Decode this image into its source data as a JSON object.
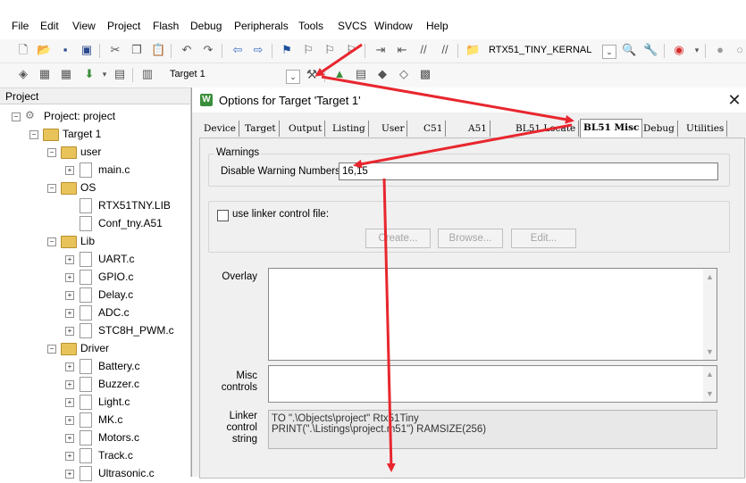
{
  "colors": {
    "arrow": "#e8262e",
    "folder": "#e8c35a",
    "app_icon": "#3a8f3a"
  },
  "menubar": {
    "items": [
      "File",
      "Edit",
      "View",
      "Project",
      "Flash",
      "Debug",
      "Peripherals",
      "Tools",
      "SVCS",
      "Window",
      "Help"
    ]
  },
  "toolbar1": {
    "target_combo": "RTX51_TINY_KERNAL",
    "icons": [
      "new-file-icon",
      "open-icon",
      "save-icon",
      "save-all-icon",
      "cut-icon",
      "copy-icon",
      "paste-icon",
      "undo-icon",
      "redo-icon",
      "nav-back-icon",
      "nav-forward-icon",
      "bookmark-icon",
      "prev-bookmark-icon",
      "next-bookmark-icon",
      "clear-bookmark-icon",
      "indent-icon",
      "unindent-icon",
      "comment-icon",
      "uncomment-icon",
      "find-in-files-icon",
      "find-icon",
      "configure-icon",
      "debug-icon",
      "breakpoint-icon"
    ]
  },
  "toolbar2": {
    "target_select": "Target 1",
    "icons": [
      "translate-icon",
      "build-icon",
      "rebuild-icon",
      "batch-build-icon",
      "stop-build-icon",
      "download-icon",
      "options-for-target-icon",
      "manage-components-icon",
      "select-software-packs-icon",
      "pack-installer-icon",
      "books-icon"
    ]
  },
  "project": {
    "header": "Project",
    "root": "Project: project",
    "target": "Target 1",
    "groups": [
      {
        "name": "user",
        "files": [
          "main.c"
        ]
      },
      {
        "name": "OS",
        "files": [
          "RTX51TNY.LIB",
          "Conf_tny.A51"
        ]
      },
      {
        "name": "Lib",
        "files": [
          "UART.c",
          "GPIO.c",
          "Delay.c",
          "ADC.c",
          "STC8H_PWM.c"
        ]
      },
      {
        "name": "Driver",
        "files": [
          "Battery.c",
          "Buzzer.c",
          "Light.c",
          "MK.c",
          "Motors.c",
          "Track.c",
          "Ultrasonic.c"
        ]
      }
    ]
  },
  "dialog": {
    "title": "Options for Target 'Target 1'",
    "close_glyph": "✕",
    "app_icon_letter": "W",
    "tabs": [
      "Device",
      "Target",
      "Output",
      "Listing",
      "User",
      "C51",
      "A51",
      "BL51 Locate",
      "BL51 Misc",
      "Debug",
      "Utilities"
    ],
    "active_tab": "BL51 Misc",
    "warnings": {
      "legend": "Warnings",
      "label": "Disable Warning Numbers:",
      "value": "16,15"
    },
    "linker_control": {
      "checkbox_label": "use linker control file:",
      "checked": false,
      "create_button": "Create...",
      "browse_button": "Browse...",
      "edit_button": "Edit..."
    },
    "overlay_label": "Overlay",
    "misc_label_line1": "Misc",
    "misc_label_line2": "controls",
    "linker_label_line1": "Linker",
    "linker_label_line2": "control",
    "linker_label_line3": "string",
    "linker_string_line1": "TO \".\\Objects\\project\" Rtx51Tiny",
    "linker_string_line2": "PRINT(\".\\Listings\\project.m51\") RAMSIZE(256)"
  }
}
